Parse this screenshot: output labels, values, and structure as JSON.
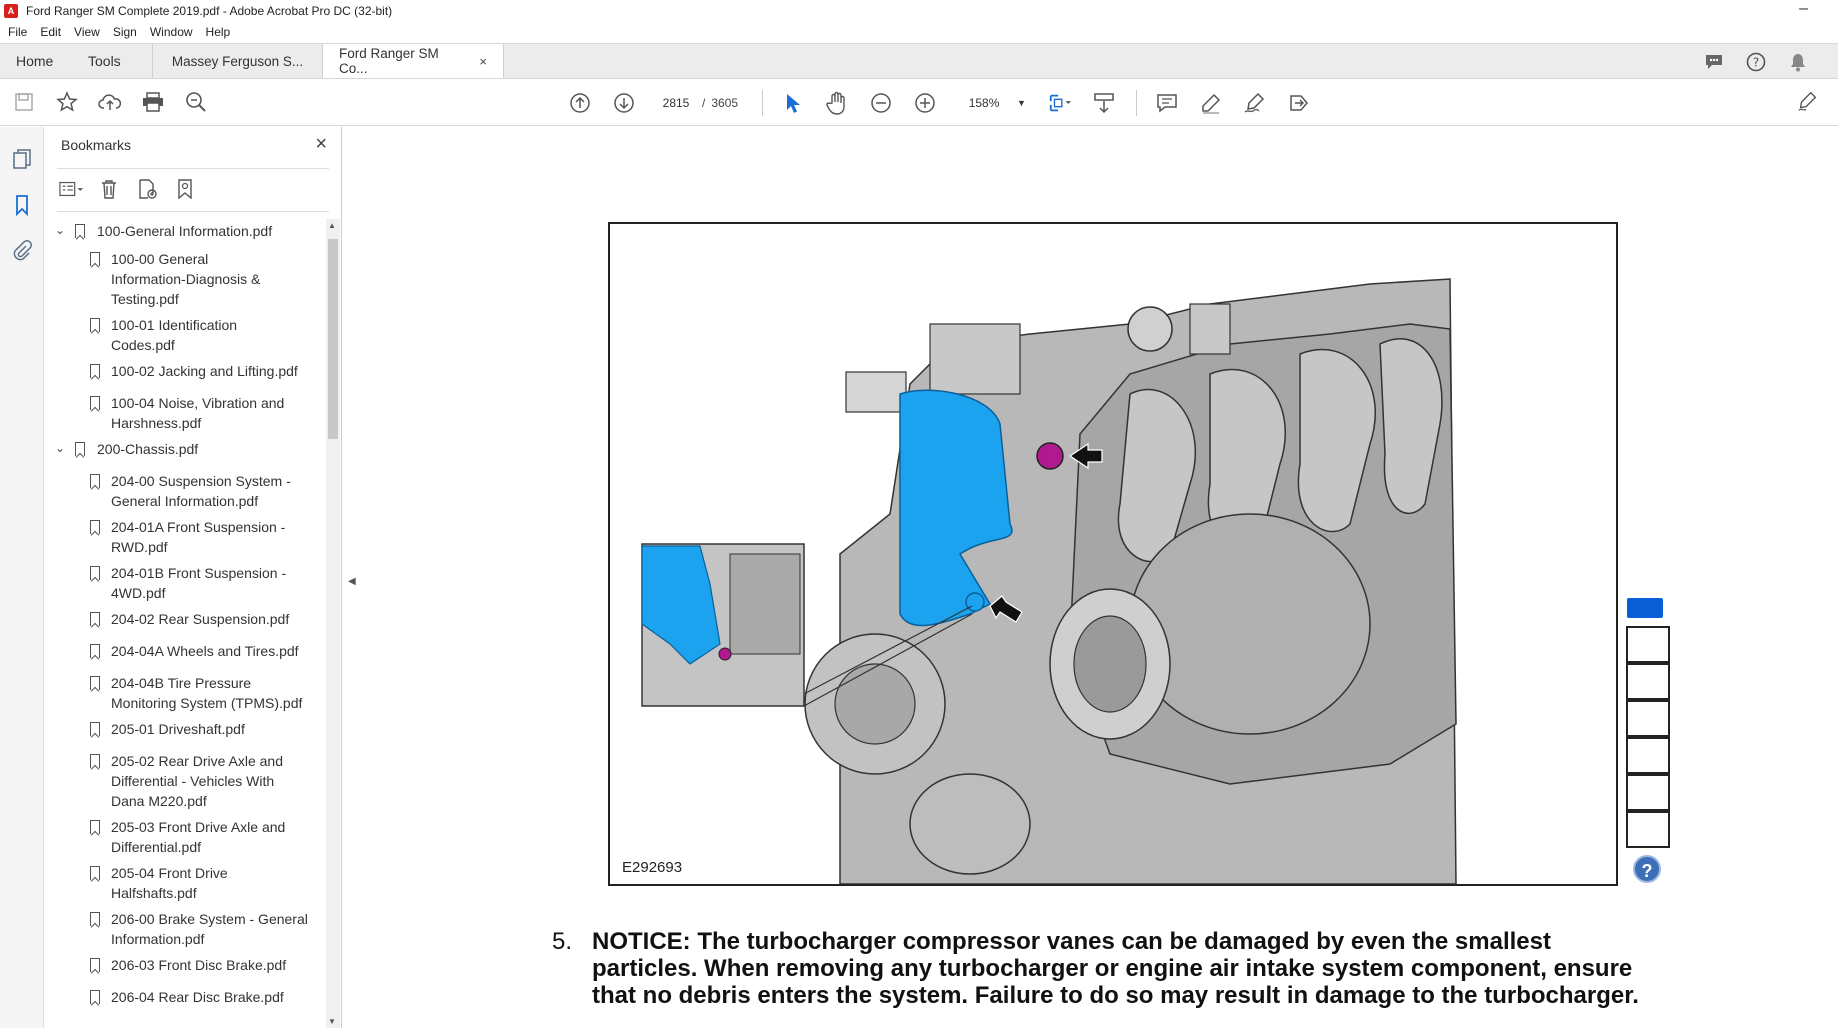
{
  "window": {
    "title": "Ford Ranger SM Complete 2019.pdf - Adobe Acrobat Pro DC (32-bit)",
    "app_icon": "acrobat-icon",
    "minimize_label": "–"
  },
  "menu": [
    "File",
    "Edit",
    "View",
    "Sign",
    "Window",
    "Help"
  ],
  "tabs": {
    "home": "Home",
    "tools": "Tools",
    "documents": [
      {
        "label": "Massey Ferguson S...",
        "active": false
      },
      {
        "label": "Ford Ranger SM Co...",
        "active": true,
        "close": "×"
      }
    ]
  },
  "toolbar": {
    "page_current": "2815",
    "page_separator": "/",
    "page_total": "3605",
    "zoom": "158%"
  },
  "bookmarks": {
    "title": "Bookmarks",
    "close": "×",
    "items": [
      {
        "level": 0,
        "expanded": true,
        "lines": [
          "100-General Information.pdf"
        ]
      },
      {
        "level": 1,
        "lines": [
          "100-00 General",
          "Information-Diagnosis &",
          "Testing.pdf"
        ]
      },
      {
        "level": 1,
        "lines": [
          "100-01 Identification",
          "Codes.pdf"
        ]
      },
      {
        "level": 1,
        "lines": [
          "100-02 Jacking and Lifting.pdf"
        ]
      },
      {
        "level": 1,
        "lines": [
          "100-04 Noise, Vibration and",
          "Harshness.pdf"
        ]
      },
      {
        "level": 0,
        "expanded": true,
        "lines": [
          "200-Chassis.pdf"
        ]
      },
      {
        "level": 1,
        "lines": [
          "204-00 Suspension System -",
          "General Information.pdf"
        ]
      },
      {
        "level": 1,
        "lines": [
          "204-01A Front Suspension -",
          "RWD.pdf"
        ]
      },
      {
        "level": 1,
        "lines": [
          "204-01B Front Suspension -",
          "4WD.pdf"
        ]
      },
      {
        "level": 1,
        "lines": [
          "204-02 Rear Suspension.pdf"
        ]
      },
      {
        "level": 1,
        "lines": [
          "204-04A Wheels and Tires.pdf"
        ]
      },
      {
        "level": 1,
        "lines": [
          "204-04B Tire Pressure",
          "Monitoring System (TPMS).pdf"
        ]
      },
      {
        "level": 1,
        "lines": [
          "205-01 Driveshaft.pdf"
        ]
      },
      {
        "level": 1,
        "lines": [
          "205-02 Rear Drive Axle and",
          "Differential - Vehicles With",
          "Dana M220.pdf"
        ]
      },
      {
        "level": 1,
        "lines": [
          "205-03 Front Drive Axle and",
          "Differential.pdf"
        ]
      },
      {
        "level": 1,
        "lines": [
          "205-04 Front Drive",
          "Halfshafts.pdf"
        ]
      },
      {
        "level": 1,
        "lines": [
          "206-00 Brake System - General",
          "Information.pdf"
        ]
      },
      {
        "level": 1,
        "lines": [
          "206-03 Front Disc Brake.pdf"
        ]
      },
      {
        "level": 1,
        "lines": [
          "206-04 Rear Disc Brake.pdf"
        ]
      }
    ]
  },
  "document": {
    "figure_id": "E292693",
    "step_number": "5.",
    "notice_text": "NOTICE: The turbocharger compressor vanes can be damaged by even the smallest particles. When removing any turbocharger or engine air intake system component, ensure that no debris enters the system. Failure to do so may result in damage to the turbocharger.",
    "help_icon": "?"
  },
  "colors": {
    "accent_blue": "#1a8fe0",
    "part_blue": "#1ba3f0",
    "bolt_magenta": "#b0198f",
    "rail_icon": "#5a6f86"
  }
}
